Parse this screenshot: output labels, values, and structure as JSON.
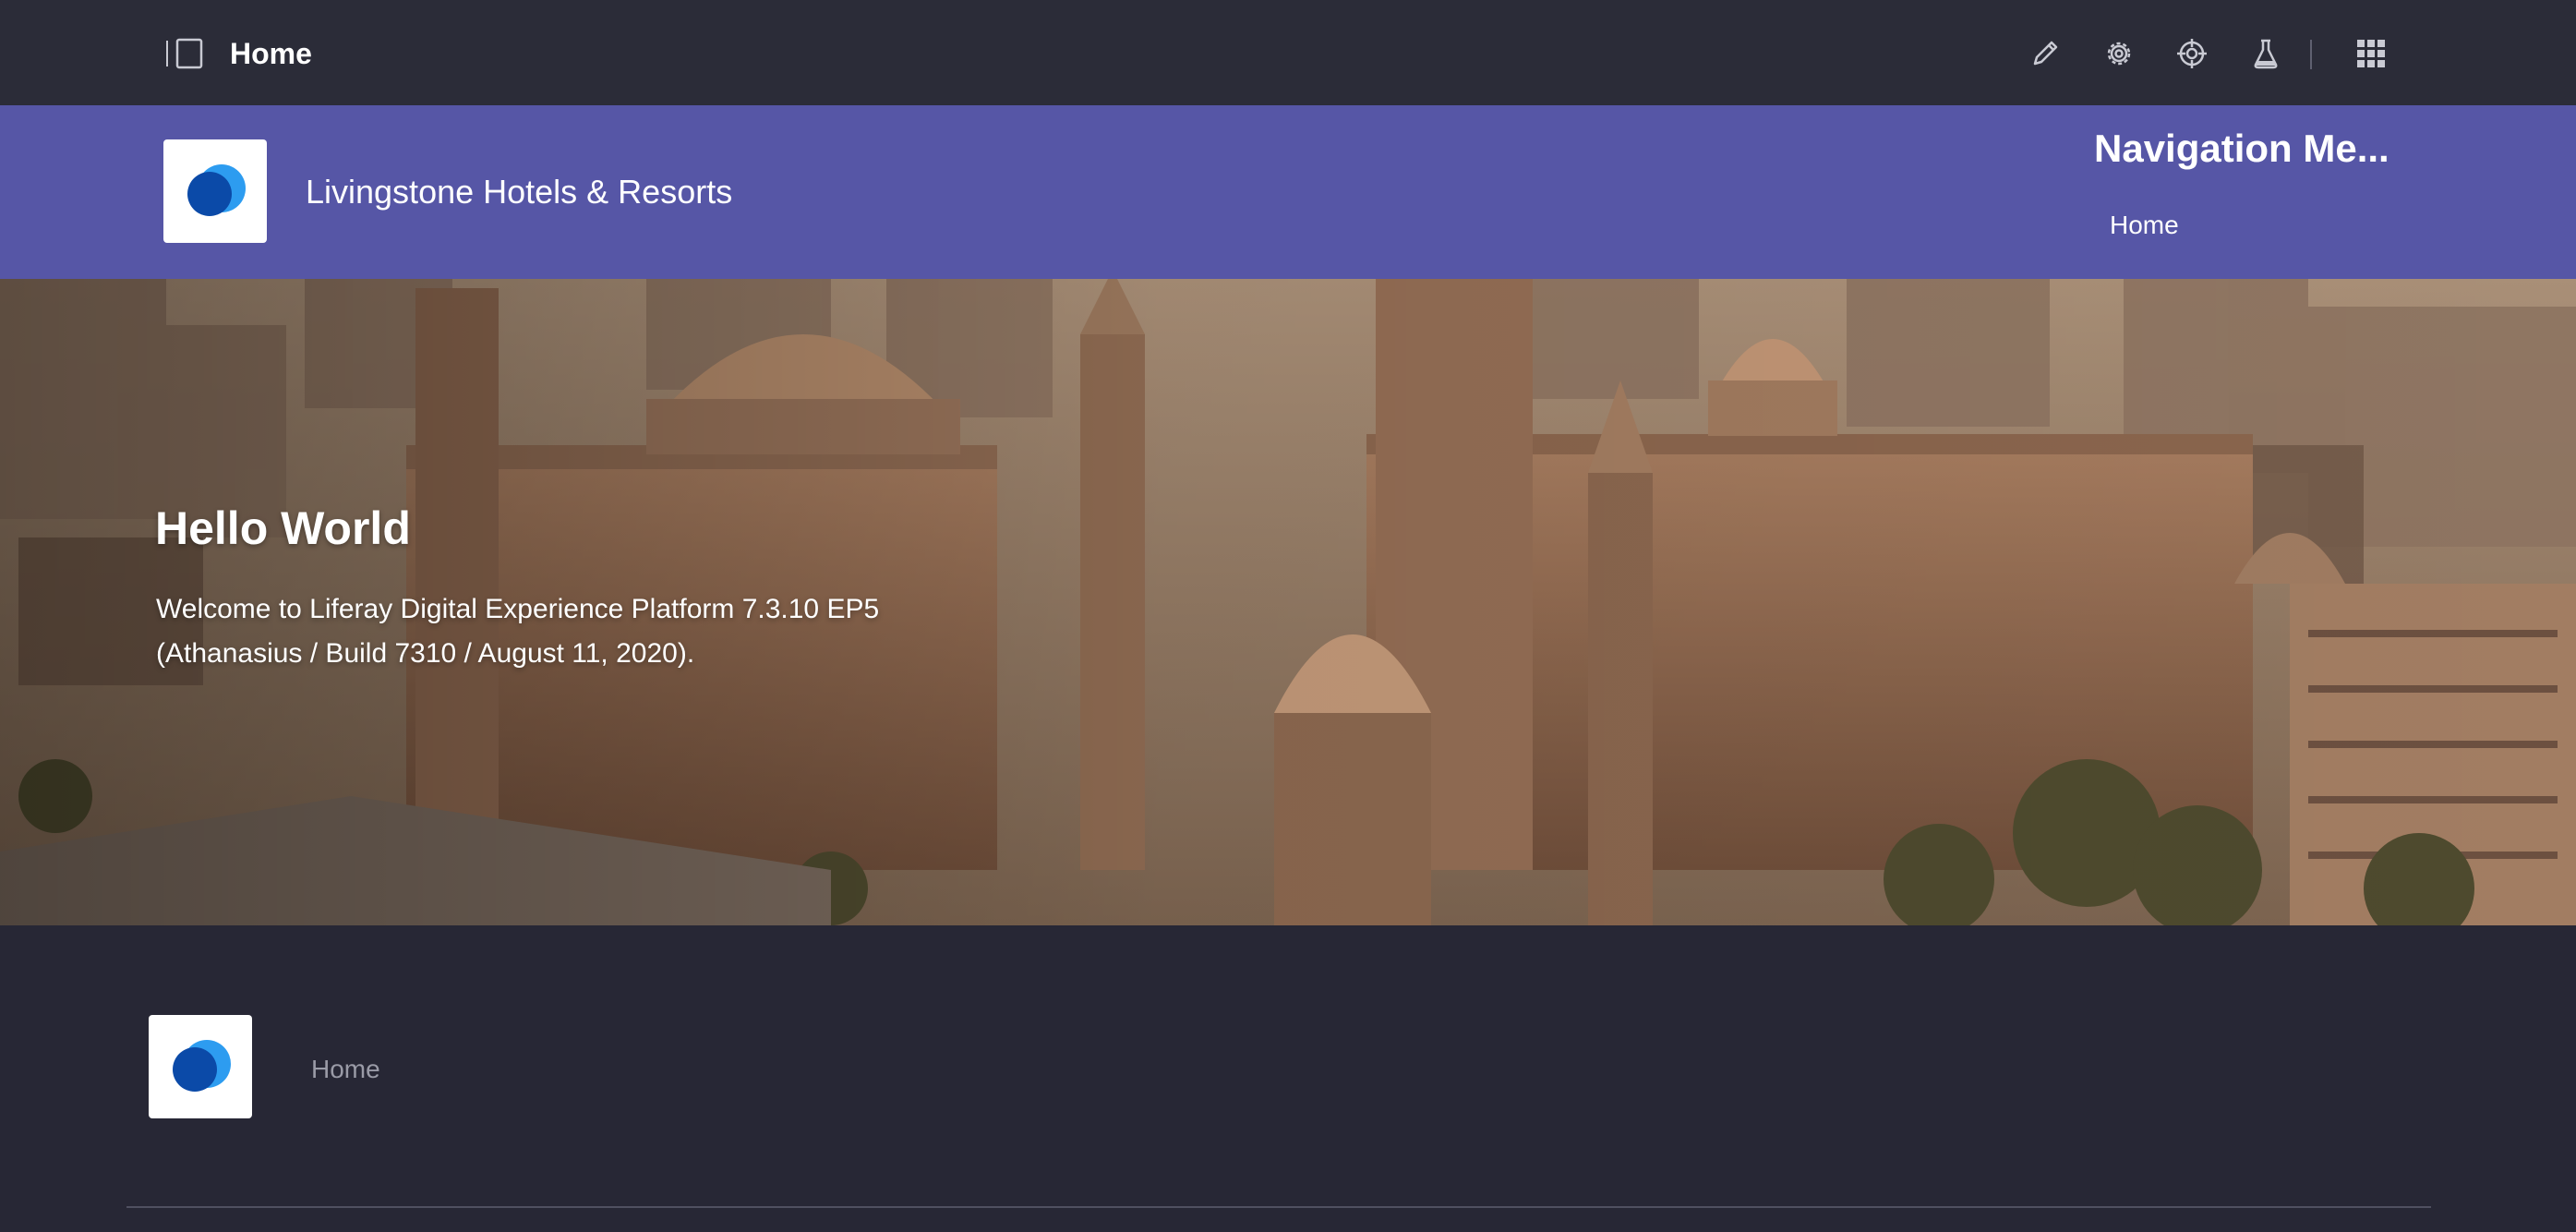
{
  "control_bar": {
    "title": "Home",
    "icons": [
      "sidebar-toggle-icon",
      "pencil-icon",
      "gear-icon",
      "target-icon",
      "flask-icon",
      "apps-grid-icon"
    ]
  },
  "site_header": {
    "site_name": "Livingstone Hotels & Resorts",
    "navigation_title": "Navigation Me...",
    "nav_items": [
      {
        "label": "Home"
      }
    ]
  },
  "hero": {
    "title": "Hello World",
    "text_line1": "Welcome to Liferay Digital Experience Platform 7.3.10 EP5",
    "text_line2": "(Athanasius / Build 7310 / August 11, 2020)."
  },
  "footer": {
    "nav_items": [
      {
        "label": "Home"
      }
    ]
  },
  "colors": {
    "control_bar_bg": "#2b2c38",
    "header_bg": "#5656a6",
    "page_bg": "#272735",
    "logo_blue_dark": "#0b4aa8",
    "logo_blue_light": "#2d9cf0"
  }
}
